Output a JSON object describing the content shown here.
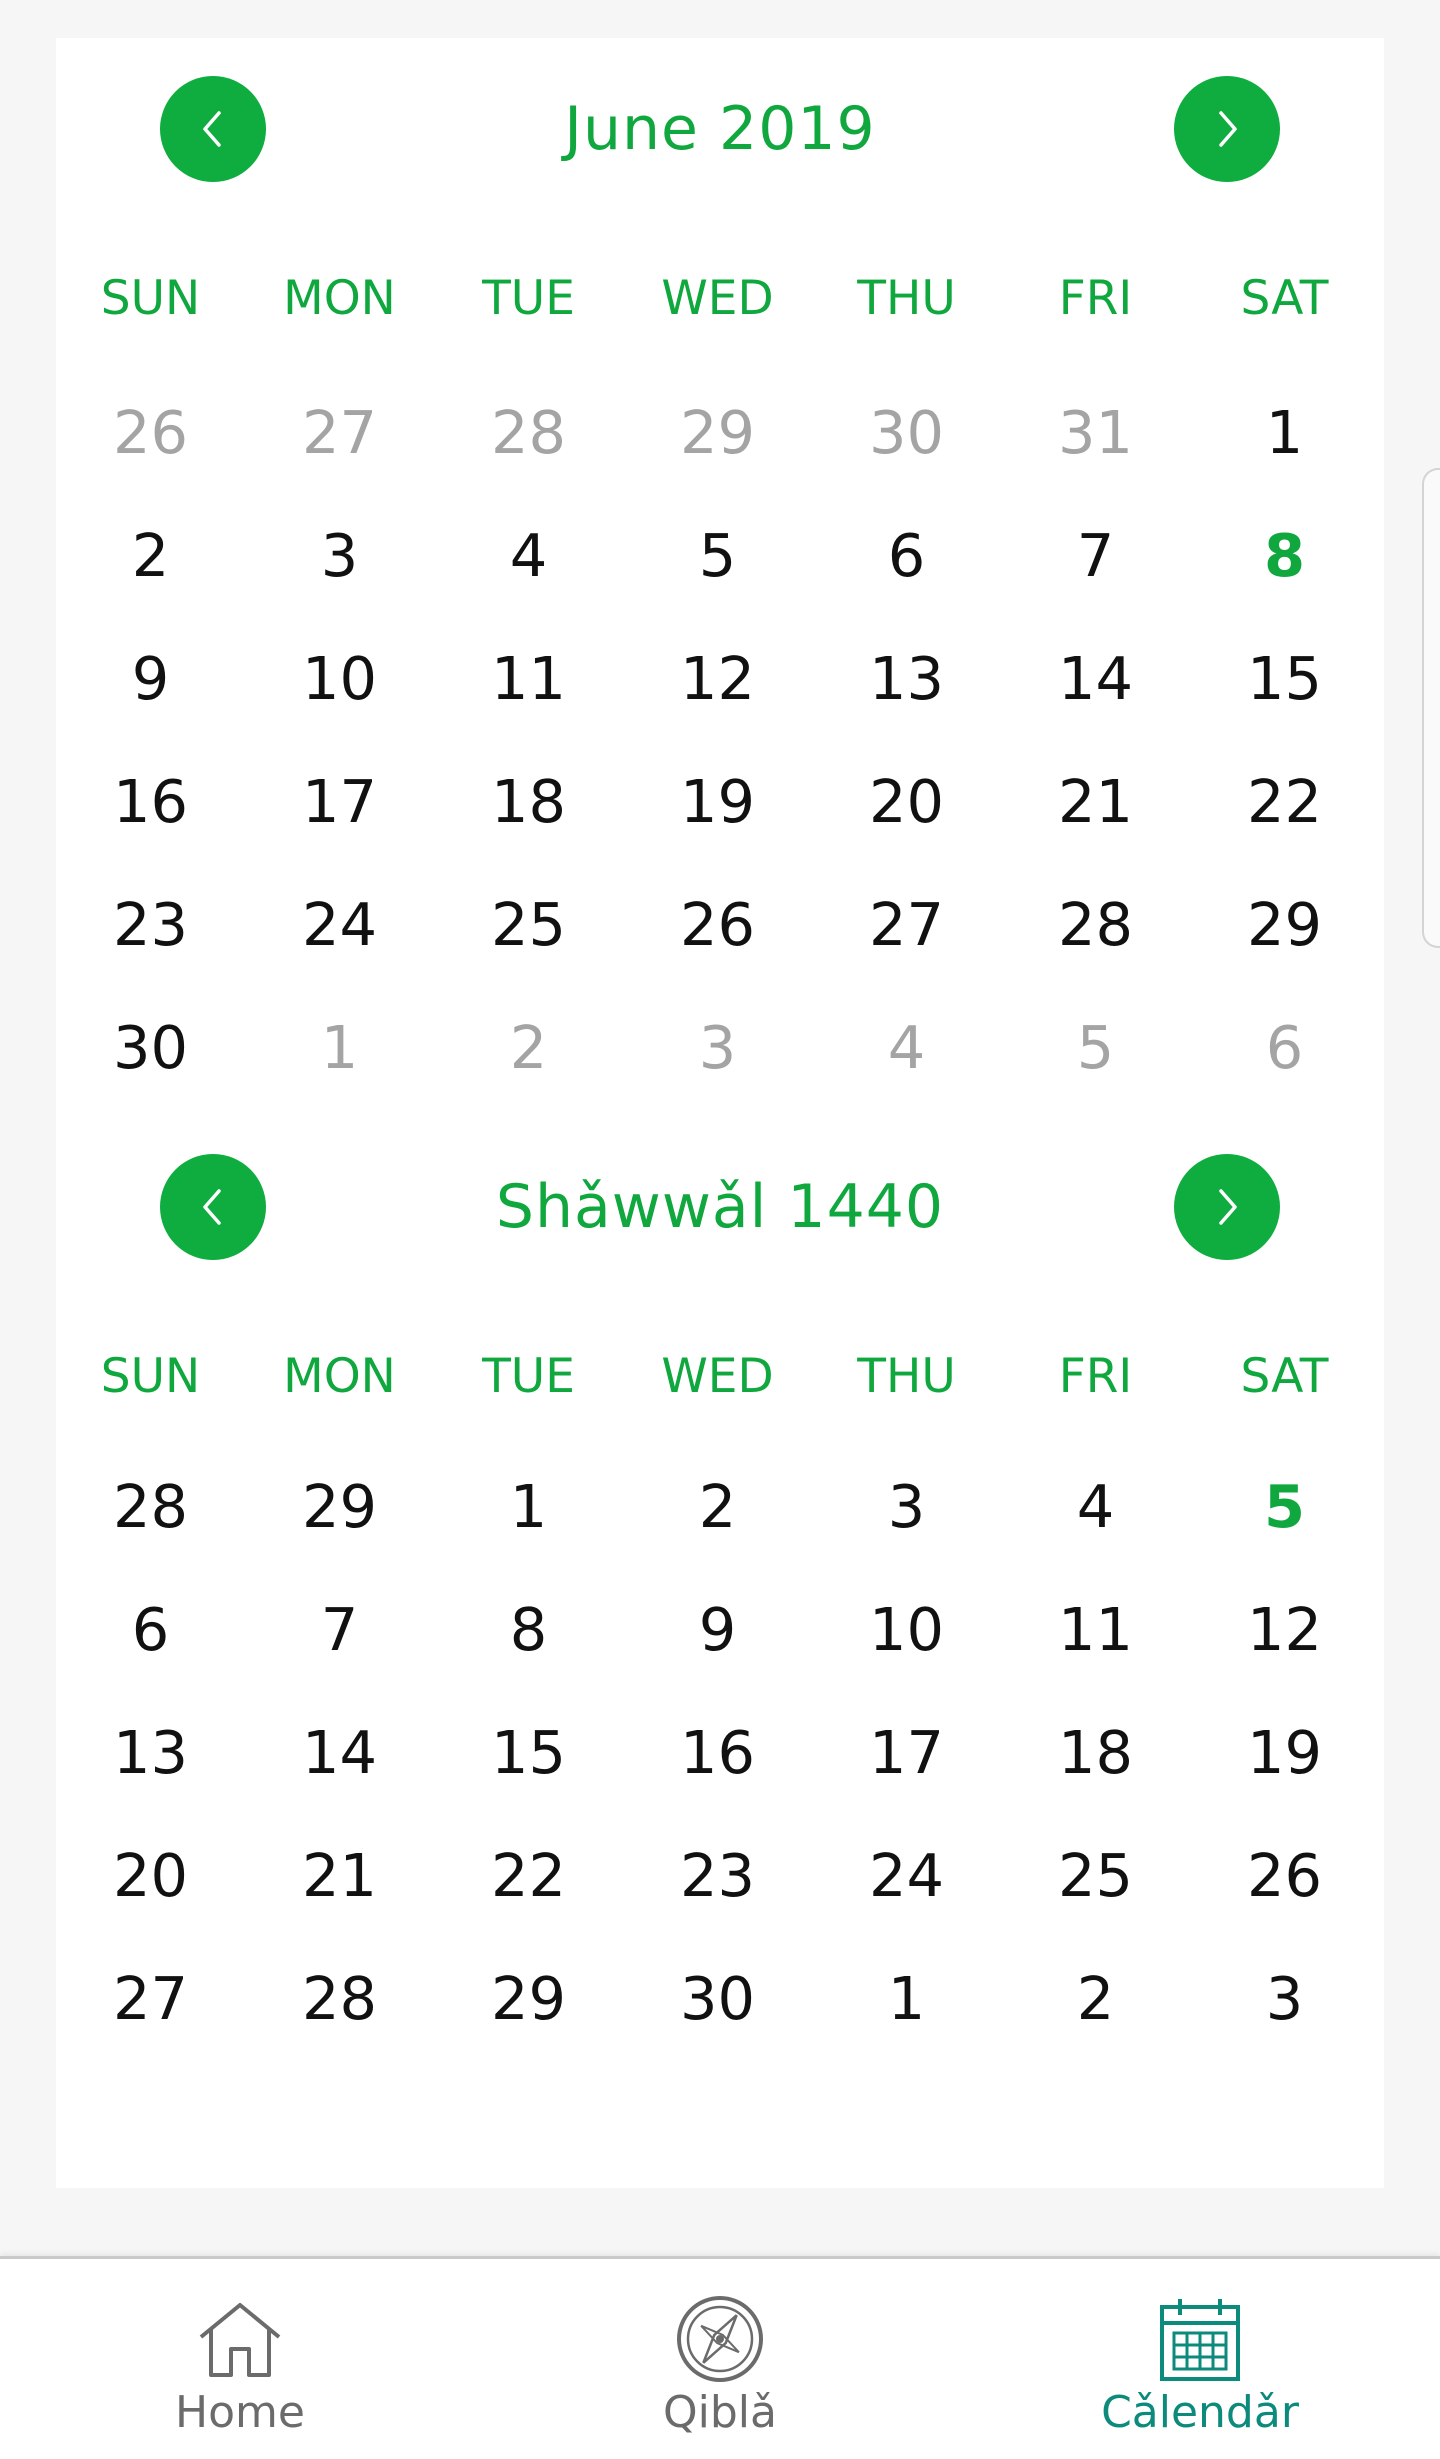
{
  "calendars": [
    {
      "title": "June 2019",
      "weekdays": [
        "SUN",
        "MON",
        "TUE",
        "WED",
        "THU",
        "FRI",
        "SAT"
      ],
      "weeks": [
        [
          {
            "d": "26",
            "muted": true
          },
          {
            "d": "27",
            "muted": true
          },
          {
            "d": "28",
            "muted": true
          },
          {
            "d": "29",
            "muted": true
          },
          {
            "d": "30",
            "muted": true
          },
          {
            "d": "31",
            "muted": true
          },
          {
            "d": "1"
          }
        ],
        [
          {
            "d": "2"
          },
          {
            "d": "3"
          },
          {
            "d": "4"
          },
          {
            "d": "5"
          },
          {
            "d": "6"
          },
          {
            "d": "7"
          },
          {
            "d": "8",
            "today": true
          }
        ],
        [
          {
            "d": "9"
          },
          {
            "d": "10"
          },
          {
            "d": "11"
          },
          {
            "d": "12"
          },
          {
            "d": "13"
          },
          {
            "d": "14"
          },
          {
            "d": "15"
          }
        ],
        [
          {
            "d": "16"
          },
          {
            "d": "17"
          },
          {
            "d": "18"
          },
          {
            "d": "19"
          },
          {
            "d": "20"
          },
          {
            "d": "21"
          },
          {
            "d": "22"
          }
        ],
        [
          {
            "d": "23"
          },
          {
            "d": "24"
          },
          {
            "d": "25"
          },
          {
            "d": "26"
          },
          {
            "d": "27"
          },
          {
            "d": "28"
          },
          {
            "d": "29"
          }
        ],
        [
          {
            "d": "30"
          },
          {
            "d": "1",
            "muted": true
          },
          {
            "d": "2",
            "muted": true
          },
          {
            "d": "3",
            "muted": true
          },
          {
            "d": "4",
            "muted": true
          },
          {
            "d": "5",
            "muted": true
          },
          {
            "d": "6",
            "muted": true
          }
        ]
      ]
    },
    {
      "title": "Shǎwwǎl 1440",
      "weekdays": [
        "SUN",
        "MON",
        "TUE",
        "WED",
        "THU",
        "FRI",
        "SAT"
      ],
      "weeks": [
        [
          {
            "d": "28"
          },
          {
            "d": "29"
          },
          {
            "d": "1"
          },
          {
            "d": "2"
          },
          {
            "d": "3"
          },
          {
            "d": "4"
          },
          {
            "d": "5",
            "today": true
          }
        ],
        [
          {
            "d": "6"
          },
          {
            "d": "7"
          },
          {
            "d": "8"
          },
          {
            "d": "9"
          },
          {
            "d": "10"
          },
          {
            "d": "11"
          },
          {
            "d": "12"
          }
        ],
        [
          {
            "d": "13"
          },
          {
            "d": "14"
          },
          {
            "d": "15"
          },
          {
            "d": "16"
          },
          {
            "d": "17"
          },
          {
            "d": "18"
          },
          {
            "d": "19"
          }
        ],
        [
          {
            "d": "20"
          },
          {
            "d": "21"
          },
          {
            "d": "22"
          },
          {
            "d": "23"
          },
          {
            "d": "24"
          },
          {
            "d": "25"
          },
          {
            "d": "26"
          }
        ],
        [
          {
            "d": "27"
          },
          {
            "d": "28"
          },
          {
            "d": "29"
          },
          {
            "d": "30"
          },
          {
            "d": "1"
          },
          {
            "d": "2"
          },
          {
            "d": "3"
          }
        ]
      ]
    }
  ],
  "nav": {
    "prev_icon": "chevron-left-icon",
    "next_icon": "chevron-right-icon"
  },
  "tabs": [
    {
      "label": "Home",
      "icon": "home-icon",
      "active": false
    },
    {
      "label": "Qiblǎ",
      "icon": "compass-icon",
      "active": false
    },
    {
      "label": "Cǎlendǎr",
      "icon": "calendar-icon",
      "active": true
    }
  ],
  "colors": {
    "accent": "#10a83e",
    "button": "#0fad3f",
    "muted_day": "#a4a4a4",
    "active_tab": "#0c8a7c",
    "inactive_tab": "#6b6b6b"
  }
}
